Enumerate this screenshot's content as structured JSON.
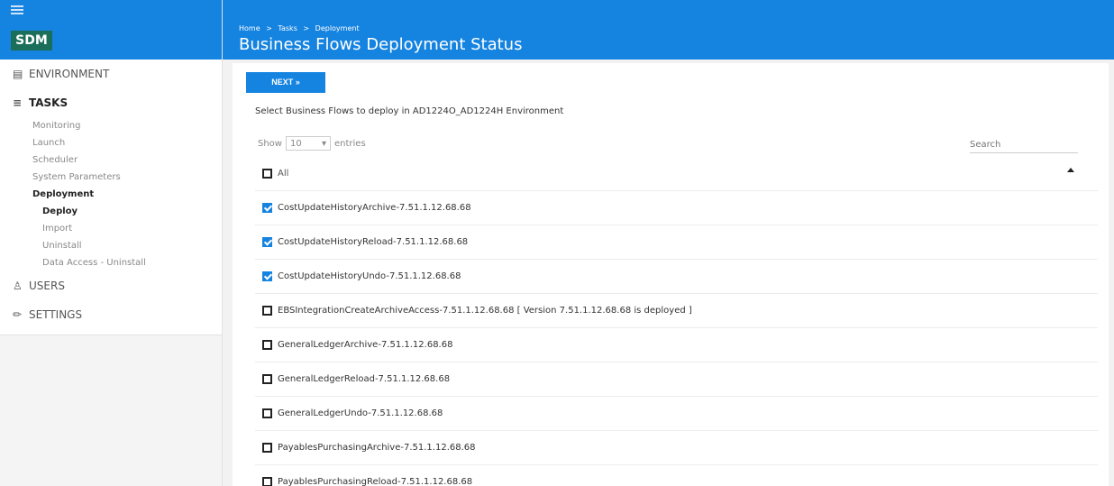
{
  "header": {
    "breadcrumb": [
      "Home",
      "Tasks",
      "Deployment"
    ],
    "breadcrumb_sep": ">",
    "title": "Business Flows Deployment Status"
  },
  "logo": "SDM",
  "nav": {
    "environment": "ENVIRONMENT",
    "tasks": "TASKS",
    "task_items": [
      "Monitoring",
      "Launch",
      "Scheduler",
      "System Parameters"
    ],
    "deployment": "Deployment",
    "deployment_items": [
      "Deploy",
      "Import",
      "Uninstall",
      "Data Access - Uninstall"
    ],
    "users": "USERS",
    "settings": "SETTINGS"
  },
  "main": {
    "next_label": "NEXT »",
    "instruction": "Select Business Flows to deploy in AD1224O_AD1224H Environment",
    "show_label": "Show",
    "entries_value": "10",
    "entries_label": "entries",
    "search_placeholder": "Search",
    "all_label": "All",
    "flows": [
      {
        "name": "CostUpdateHistoryArchive-7.51.1.12.68.68",
        "checked": true
      },
      {
        "name": "CostUpdateHistoryReload-7.51.1.12.68.68",
        "checked": true
      },
      {
        "name": "CostUpdateHistoryUndo-7.51.1.12.68.68",
        "checked": true
      },
      {
        "name": "EBSIntegrationCreateArchiveAccess-7.51.1.12.68.68 [ Version 7.51.1.12.68.68 is deployed ]",
        "checked": false
      },
      {
        "name": "GeneralLedgerArchive-7.51.1.12.68.68",
        "checked": false
      },
      {
        "name": "GeneralLedgerReload-7.51.1.12.68.68",
        "checked": false
      },
      {
        "name": "GeneralLedgerUndo-7.51.1.12.68.68",
        "checked": false
      },
      {
        "name": "PayablesPurchasingArchive-7.51.1.12.68.68",
        "checked": false
      },
      {
        "name": "PayablesPurchasingReload-7.51.1.12.68.68",
        "checked": false
      }
    ]
  },
  "colors": {
    "brand_blue": "#1583e0",
    "logo_green": "#1a6e5a"
  }
}
